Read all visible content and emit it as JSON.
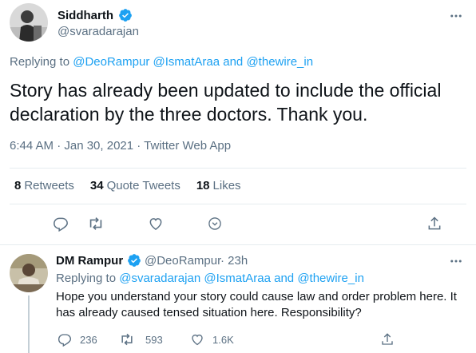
{
  "main_tweet": {
    "author_name": "Siddharth",
    "author_handle": "@svaradarajan",
    "replying_prefix": "Replying to",
    "mentions": [
      "@DeoRampur",
      "@IsmatAraa",
      "and",
      "@thewire_in"
    ],
    "text": "Story has already been updated to include the official declaration by the three doctors. Thank you.",
    "timestamp": "6:44 AM · Jan 30, 2021 · Twitter Web App",
    "stats": {
      "retweets_count": "8",
      "retweets_label": "Retweets",
      "quote_count": "34",
      "quote_label": "Quote Tweets",
      "likes_count": "18",
      "likes_label": "Likes"
    },
    "icons": [
      "reply-icon",
      "retweet-icon",
      "like-icon",
      "caret-icon",
      "share-icon"
    ]
  },
  "reply_tweet": {
    "author_name": "DM Rampur",
    "author_handle": "@DeoRampur",
    "time_ago": "· 23h",
    "replying_prefix": "Replying to",
    "mentions": [
      "@svaradarajan",
      "@IsmatAraa",
      "and",
      "@thewire_in"
    ],
    "text": "Hope you understand your story could cause law and order problem here. It has already caused tensed situation here. Responsibility?",
    "actions": {
      "reply_count": "236",
      "retweet_count": "593",
      "like_count": "1.6K"
    }
  },
  "colors": {
    "accent": "#1da1f2",
    "muted": "#5b7083",
    "text": "#0f1419",
    "divider": "#e6ecf0"
  }
}
